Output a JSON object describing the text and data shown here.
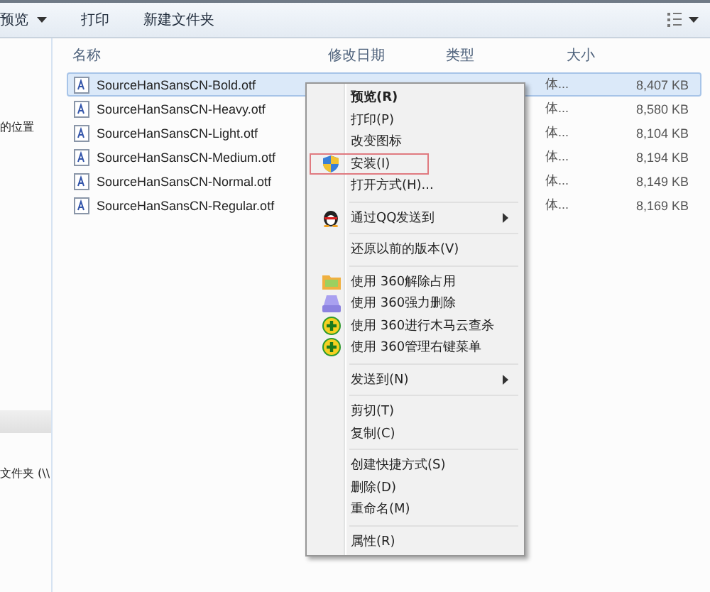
{
  "toolbar": {
    "buttons": [
      {
        "label": "预览",
        "dropdown": true
      },
      {
        "label": "打印",
        "dropdown": false
      },
      {
        "label": "新建文件夹",
        "dropdown": false
      }
    ]
  },
  "sidebar": {
    "items": [
      {
        "label": "的位置",
        "selected": false
      },
      {
        "label": "文件夹 (\\\\",
        "selected": false
      }
    ]
  },
  "table": {
    "columns": [
      "名称",
      "修改日期",
      "类型",
      "大小"
    ],
    "rows": [
      {
        "name": "SourceHanSansCN-Bold.otf",
        "type": "体...",
        "size": "8,407 KB",
        "selected": true
      },
      {
        "name": "SourceHanSansCN-Heavy.otf",
        "type": "体...",
        "size": "8,580 KB",
        "selected": false
      },
      {
        "name": "SourceHanSansCN-Light.otf",
        "type": "体...",
        "size": "8,104 KB",
        "selected": false
      },
      {
        "name": "SourceHanSansCN-Medium.otf",
        "type": "体...",
        "size": "8,194 KB",
        "selected": false
      },
      {
        "name": "SourceHanSansCN-Normal.otf",
        "type": "体...",
        "size": "8,149 KB",
        "selected": false
      },
      {
        "name": "SourceHanSansCN-Regular.otf",
        "type": "体...",
        "size": "8,169 KB",
        "selected": false
      }
    ]
  },
  "context_menu": {
    "items": [
      {
        "kind": "item",
        "label": "预览(R)",
        "bold": true,
        "submenu": false,
        "selected": false
      },
      {
        "kind": "item",
        "label": "打印(P)",
        "bold": false,
        "submenu": false,
        "selected": false
      },
      {
        "kind": "item",
        "label": "改变图标",
        "bold": false,
        "submenu": false,
        "selected": false
      },
      {
        "kind": "item",
        "label": "安装(I)",
        "bold": false,
        "submenu": false,
        "selected": true
      },
      {
        "kind": "item",
        "label": "打开方式(H)...",
        "bold": false,
        "submenu": false,
        "selected": false
      },
      {
        "kind": "separator"
      },
      {
        "kind": "item",
        "label": "通过QQ发送到",
        "bold": false,
        "submenu": true,
        "selected": false
      },
      {
        "kind": "separator"
      },
      {
        "kind": "item",
        "label": "还原以前的版本(V)",
        "bold": false,
        "submenu": false,
        "selected": false
      },
      {
        "kind": "separator"
      },
      {
        "kind": "item",
        "label": "使用 360解除占用",
        "bold": false,
        "submenu": false,
        "selected": false
      },
      {
        "kind": "item",
        "label": "使用 360强力删除",
        "bold": false,
        "submenu": false,
        "selected": false
      },
      {
        "kind": "item",
        "label": "使用 360进行木马云查杀",
        "bold": false,
        "submenu": false,
        "selected": false
      },
      {
        "kind": "item",
        "label": "使用 360管理右键菜单",
        "bold": false,
        "submenu": false,
        "selected": false
      },
      {
        "kind": "separator"
      },
      {
        "kind": "item",
        "label": "发送到(N)",
        "bold": false,
        "submenu": true,
        "selected": false
      },
      {
        "kind": "separator"
      },
      {
        "kind": "item",
        "label": "剪切(T)",
        "bold": false,
        "submenu": false,
        "selected": false
      },
      {
        "kind": "item",
        "label": "复制(C)",
        "bold": false,
        "submenu": false,
        "selected": false
      },
      {
        "kind": "separator"
      },
      {
        "kind": "item",
        "label": "创建快捷方式(S)",
        "bold": false,
        "submenu": false,
        "selected": false
      },
      {
        "kind": "item",
        "label": "删除(D)",
        "bold": false,
        "submenu": false,
        "selected": false
      },
      {
        "kind": "item",
        "label": "重命名(M)",
        "bold": false,
        "submenu": false,
        "selected": false
      },
      {
        "kind": "separator"
      },
      {
        "kind": "item",
        "label": "属性(R)",
        "bold": false,
        "submenu": false,
        "selected": false
      }
    ]
  }
}
